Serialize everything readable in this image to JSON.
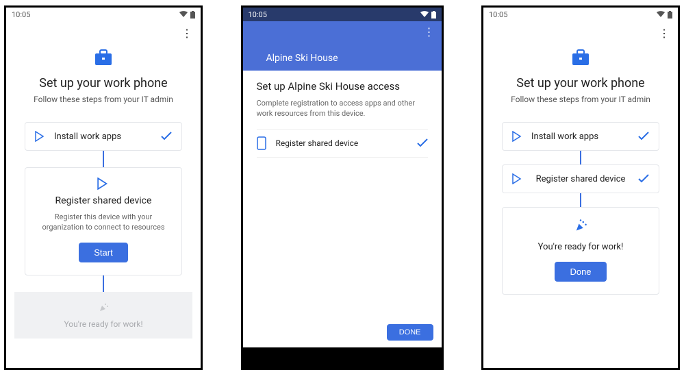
{
  "status": {
    "time": "10:05"
  },
  "screen1": {
    "title": "Set up your work phone",
    "subtitle": "Follow these steps from your IT admin",
    "step1_label": "Install work apps",
    "step2_title": "Register shared device",
    "step2_desc": "Register this device with your organization to connect to resources",
    "start_btn": "Start",
    "ready_text": "You're ready for work!"
  },
  "screen2": {
    "org": "Alpine Ski House",
    "title": "Set up Alpine Ski House access",
    "subtitle": "Complete registration to access apps and other work resources from this device.",
    "row_label": "Register shared device",
    "done_btn": "DONE"
  },
  "screen3": {
    "title": "Set up your work phone",
    "subtitle": "Follow these steps from your IT admin",
    "step1_label": "Install work apps",
    "step2_label": "Register shared device",
    "ready_text": "You're ready for work!",
    "done_btn": "Done"
  }
}
